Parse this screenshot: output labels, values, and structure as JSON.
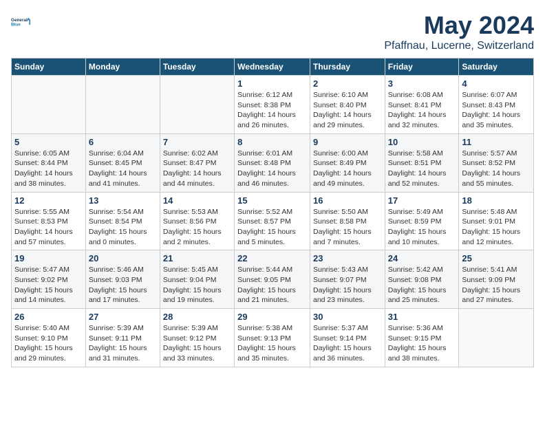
{
  "logo": {
    "line1": "General",
    "line2": "Blue"
  },
  "title": "May 2024",
  "location": "Pfaffnau, Lucerne, Switzerland",
  "weekdays": [
    "Sunday",
    "Monday",
    "Tuesday",
    "Wednesday",
    "Thursday",
    "Friday",
    "Saturday"
  ],
  "weeks": [
    [
      {
        "day": "",
        "info": ""
      },
      {
        "day": "",
        "info": ""
      },
      {
        "day": "",
        "info": ""
      },
      {
        "day": "1",
        "info": "Sunrise: 6:12 AM\nSunset: 8:38 PM\nDaylight: 14 hours\nand 26 minutes."
      },
      {
        "day": "2",
        "info": "Sunrise: 6:10 AM\nSunset: 8:40 PM\nDaylight: 14 hours\nand 29 minutes."
      },
      {
        "day": "3",
        "info": "Sunrise: 6:08 AM\nSunset: 8:41 PM\nDaylight: 14 hours\nand 32 minutes."
      },
      {
        "day": "4",
        "info": "Sunrise: 6:07 AM\nSunset: 8:43 PM\nDaylight: 14 hours\nand 35 minutes."
      }
    ],
    [
      {
        "day": "5",
        "info": "Sunrise: 6:05 AM\nSunset: 8:44 PM\nDaylight: 14 hours\nand 38 minutes."
      },
      {
        "day": "6",
        "info": "Sunrise: 6:04 AM\nSunset: 8:45 PM\nDaylight: 14 hours\nand 41 minutes."
      },
      {
        "day": "7",
        "info": "Sunrise: 6:02 AM\nSunset: 8:47 PM\nDaylight: 14 hours\nand 44 minutes."
      },
      {
        "day": "8",
        "info": "Sunrise: 6:01 AM\nSunset: 8:48 PM\nDaylight: 14 hours\nand 46 minutes."
      },
      {
        "day": "9",
        "info": "Sunrise: 6:00 AM\nSunset: 8:49 PM\nDaylight: 14 hours\nand 49 minutes."
      },
      {
        "day": "10",
        "info": "Sunrise: 5:58 AM\nSunset: 8:51 PM\nDaylight: 14 hours\nand 52 minutes."
      },
      {
        "day": "11",
        "info": "Sunrise: 5:57 AM\nSunset: 8:52 PM\nDaylight: 14 hours\nand 55 minutes."
      }
    ],
    [
      {
        "day": "12",
        "info": "Sunrise: 5:55 AM\nSunset: 8:53 PM\nDaylight: 14 hours\nand 57 minutes."
      },
      {
        "day": "13",
        "info": "Sunrise: 5:54 AM\nSunset: 8:54 PM\nDaylight: 15 hours\nand 0 minutes."
      },
      {
        "day": "14",
        "info": "Sunrise: 5:53 AM\nSunset: 8:56 PM\nDaylight: 15 hours\nand 2 minutes."
      },
      {
        "day": "15",
        "info": "Sunrise: 5:52 AM\nSunset: 8:57 PM\nDaylight: 15 hours\nand 5 minutes."
      },
      {
        "day": "16",
        "info": "Sunrise: 5:50 AM\nSunset: 8:58 PM\nDaylight: 15 hours\nand 7 minutes."
      },
      {
        "day": "17",
        "info": "Sunrise: 5:49 AM\nSunset: 8:59 PM\nDaylight: 15 hours\nand 10 minutes."
      },
      {
        "day": "18",
        "info": "Sunrise: 5:48 AM\nSunset: 9:01 PM\nDaylight: 15 hours\nand 12 minutes."
      }
    ],
    [
      {
        "day": "19",
        "info": "Sunrise: 5:47 AM\nSunset: 9:02 PM\nDaylight: 15 hours\nand 14 minutes."
      },
      {
        "day": "20",
        "info": "Sunrise: 5:46 AM\nSunset: 9:03 PM\nDaylight: 15 hours\nand 17 minutes."
      },
      {
        "day": "21",
        "info": "Sunrise: 5:45 AM\nSunset: 9:04 PM\nDaylight: 15 hours\nand 19 minutes."
      },
      {
        "day": "22",
        "info": "Sunrise: 5:44 AM\nSunset: 9:05 PM\nDaylight: 15 hours\nand 21 minutes."
      },
      {
        "day": "23",
        "info": "Sunrise: 5:43 AM\nSunset: 9:07 PM\nDaylight: 15 hours\nand 23 minutes."
      },
      {
        "day": "24",
        "info": "Sunrise: 5:42 AM\nSunset: 9:08 PM\nDaylight: 15 hours\nand 25 minutes."
      },
      {
        "day": "25",
        "info": "Sunrise: 5:41 AM\nSunset: 9:09 PM\nDaylight: 15 hours\nand 27 minutes."
      }
    ],
    [
      {
        "day": "26",
        "info": "Sunrise: 5:40 AM\nSunset: 9:10 PM\nDaylight: 15 hours\nand 29 minutes."
      },
      {
        "day": "27",
        "info": "Sunrise: 5:39 AM\nSunset: 9:11 PM\nDaylight: 15 hours\nand 31 minutes."
      },
      {
        "day": "28",
        "info": "Sunrise: 5:39 AM\nSunset: 9:12 PM\nDaylight: 15 hours\nand 33 minutes."
      },
      {
        "day": "29",
        "info": "Sunrise: 5:38 AM\nSunset: 9:13 PM\nDaylight: 15 hours\nand 35 minutes."
      },
      {
        "day": "30",
        "info": "Sunrise: 5:37 AM\nSunset: 9:14 PM\nDaylight: 15 hours\nand 36 minutes."
      },
      {
        "day": "31",
        "info": "Sunrise: 5:36 AM\nSunset: 9:15 PM\nDaylight: 15 hours\nand 38 minutes."
      },
      {
        "day": "",
        "info": ""
      }
    ]
  ]
}
